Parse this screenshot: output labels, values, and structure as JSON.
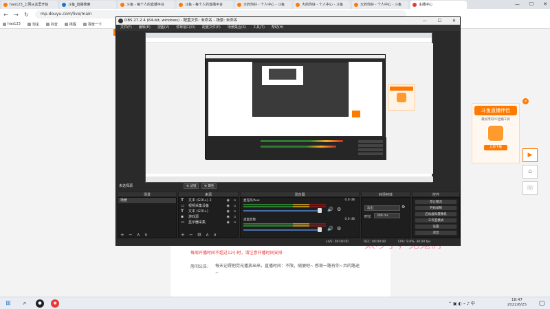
{
  "browser": {
    "tabs": [
      {
        "label": "hao123_上网从这里开始",
        "fav": "orange"
      },
      {
        "label": "斗鱼_直播搜索",
        "fav": "blue"
      },
      {
        "label": "斗鱼 - 每个人的直播平台",
        "fav": "orange"
      },
      {
        "label": "斗鱼 - 每个人的直播平台",
        "fav": "orange"
      },
      {
        "label": "大的你好 - 个人中心 - 斗鱼",
        "fav": "orange"
      },
      {
        "label": "大的你好 - 个人中心 - 斗鱼",
        "fav": "orange"
      },
      {
        "label": "大的你好 - 个人中心 - 斗鱼",
        "fav": "orange"
      },
      {
        "label": "主播中心",
        "fav": "orange"
      }
    ],
    "url": "mp.douyu.com/live/main",
    "bookmarks": [
      "hao123",
      "淘宝",
      "抖音",
      "携程",
      "百度一下"
    ],
    "window_buttons": [
      "—",
      "☐",
      "✕"
    ]
  },
  "page": {
    "notice_red": "每周开播时间不超过12小时，请注意开播时间安排",
    "announcement_label": "房间公告:",
    "announcement_text": "每天记得把觉光播放出来，直播时间：不限，随便吧~ 感谢一路有你~共的路途~",
    "overlay_text": "太吵了，见鬼们",
    "watermark": "Ok 直播"
  },
  "douyu_card": {
    "title": "斗鱼直播伴侣",
    "subtitle": "最好用的PC直播工具",
    "download": "立即下载",
    "close": "×"
  },
  "obs": {
    "title": "OBS 27.2.4 (64-bit, windows) - 配置文件: 未命名 - 场景: 未命名",
    "window_buttons": [
      "—",
      "☐",
      "✕"
    ],
    "menu": [
      "文件(F)",
      "编辑(E)",
      "视图(V)",
      "停靠窗口(D)",
      "配置文件(P)",
      "场景集合(S)",
      "工具(T)",
      "帮助(H)"
    ],
    "no_source": "未选择源",
    "filters_btn": "滤镜",
    "props_btn": "属性",
    "docks": {
      "scenes_title": "场景",
      "sources_title": "来源",
      "mixer_title": "混音器",
      "transitions_title": "转场特效",
      "controls_title": "控件"
    },
    "scenes": [
      "场景"
    ],
    "sources": [
      {
        "type": "T",
        "label": "文本 (GDI+) 2"
      },
      {
        "type": "",
        "label": "视频采集设备"
      },
      {
        "type": "T",
        "label": "文本 (GDI+)"
      },
      {
        "type": "",
        "label": "游戏源"
      },
      {
        "type": "",
        "label": "显示器采集"
      }
    ],
    "mixer": [
      {
        "name": "麦克风/Aux",
        "db": "0.0 dB"
      },
      {
        "name": "桌面音频",
        "db": "0.0 dB"
      }
    ],
    "transition": {
      "value": "淡出",
      "duration_label": "时长",
      "duration": "300 ms"
    },
    "controls": [
      "停止推流",
      "开始录制",
      "启动虚拟摄像机",
      "工作室模式",
      "设置",
      "退出"
    ],
    "status": {
      "live": "LIVE: 00:00:00",
      "rec": "REC: 00:00:00",
      "cpu": "CPU: 9.0%, 30.00 fps"
    }
  },
  "taskbar": {
    "time": "18:47",
    "date": "2022/6/25"
  }
}
